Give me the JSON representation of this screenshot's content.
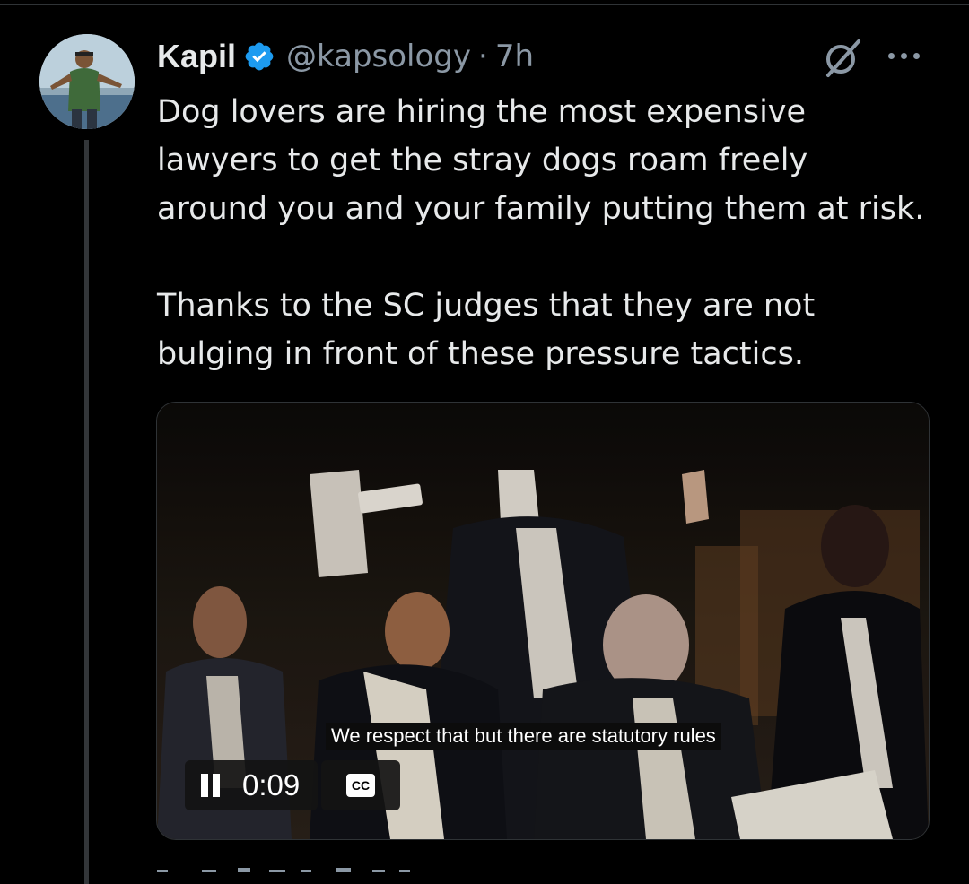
{
  "tweet": {
    "author_name": "Kapil",
    "handle": "@kapsology",
    "separator": "·",
    "time": "7h",
    "text": "Dog lovers are hiring the most expensive\nlawyers to get the stray dogs roam freely\naround you and your family putting them at risk.\n\nThanks to the SC judges that they are not\nbulging in front of these pressure tactics."
  },
  "video": {
    "caption": "We respect that but there are statutory rules",
    "timecode": "0:09",
    "cc_label": "CC",
    "state": "playing"
  },
  "icons": {
    "verified": "verified-badge-icon",
    "grok": "grok-icon",
    "more": "more-options-icon"
  },
  "colors": {
    "background": "#000000",
    "text_primary": "#e7e9ea",
    "text_secondary": "#8b98a5",
    "verified_blue": "#1d9bf0",
    "divider": "#2f3336"
  }
}
